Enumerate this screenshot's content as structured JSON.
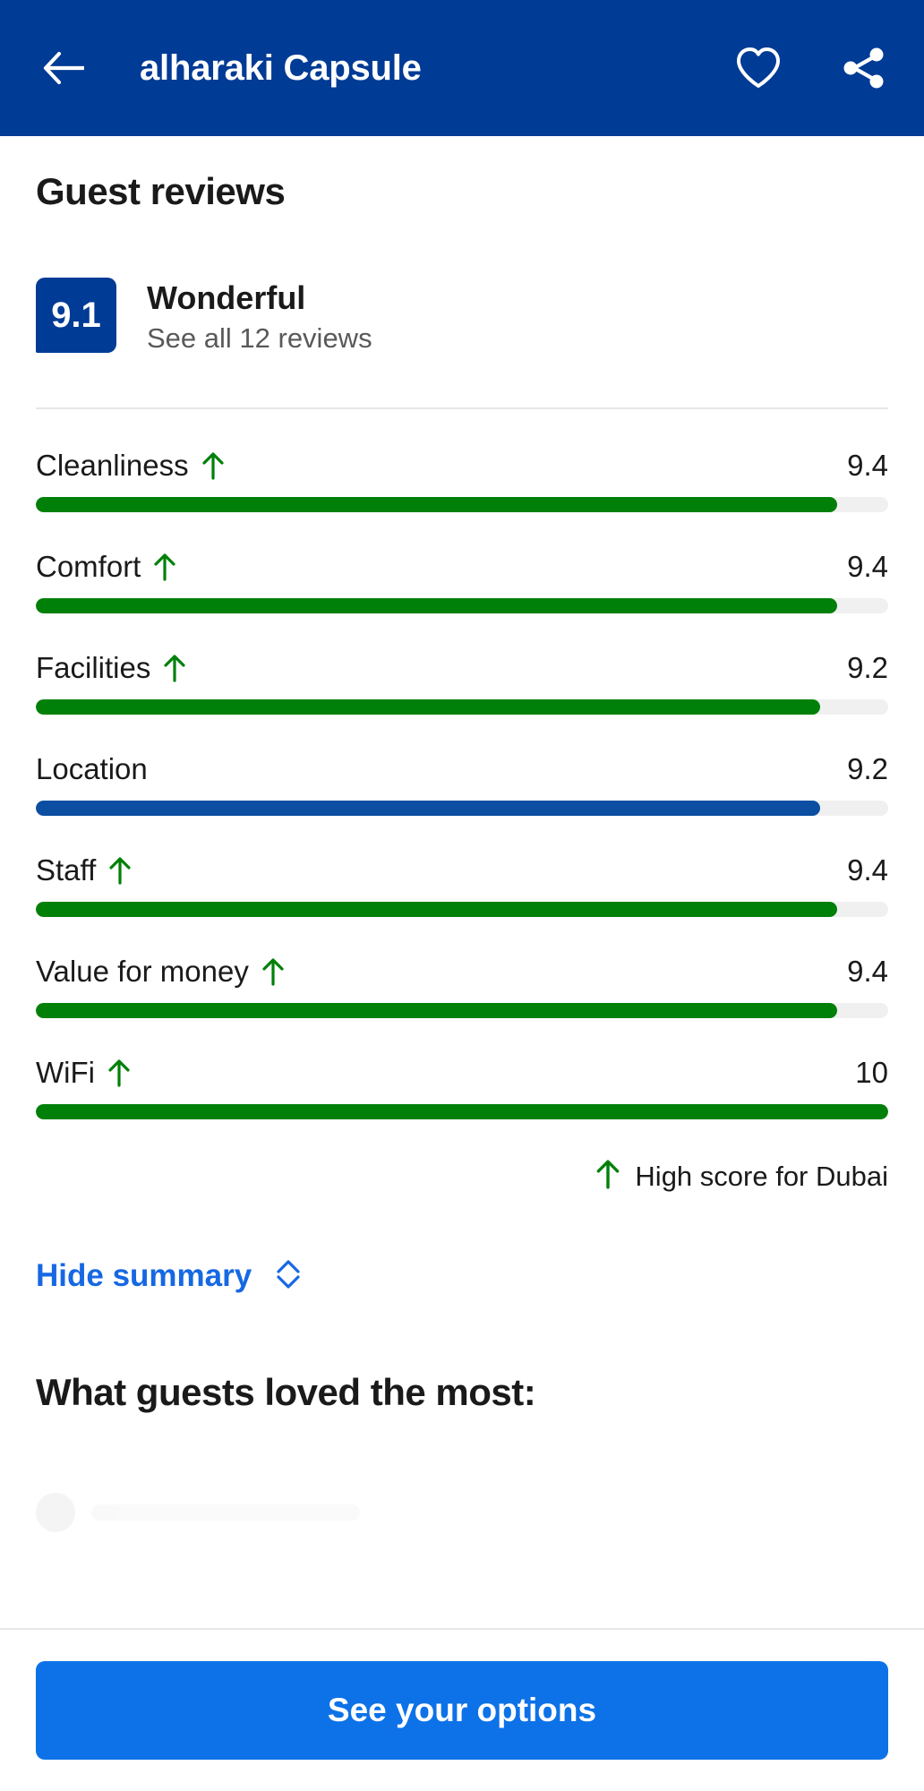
{
  "header": {
    "title": "alharaki Capsule",
    "back_icon": "back-arrow-icon",
    "favorite_icon": "heart-icon",
    "share_icon": "share-icon",
    "background_color": "#003b95"
  },
  "reviews": {
    "section_title": "Guest reviews",
    "score": "9.1",
    "score_word": "Wonderful",
    "see_all_label": "See all 12 reviews",
    "review_count": 12,
    "badge_color": "#003b95"
  },
  "categories": [
    {
      "label": "Cleanliness",
      "value": "9.4",
      "percent": 94,
      "color": "#008009",
      "high_score": true
    },
    {
      "label": "Comfort",
      "value": "9.4",
      "percent": 94,
      "color": "#008009",
      "high_score": true
    },
    {
      "label": "Facilities",
      "value": "9.2",
      "percent": 92,
      "color": "#008009",
      "high_score": true
    },
    {
      "label": "Location",
      "value": "9.2",
      "percent": 92,
      "color": "#0b4ea2",
      "high_score": false
    },
    {
      "label": "Staff",
      "value": "9.4",
      "percent": 94,
      "color": "#008009",
      "high_score": true
    },
    {
      "label": "Value for money",
      "value": "9.4",
      "percent": 94,
      "color": "#008009",
      "high_score": true
    },
    {
      "label": "WiFi",
      "value": "10",
      "percent": 100,
      "color": "#008009",
      "high_score": true
    }
  ],
  "legend": {
    "arrow_icon": "up-arrow-icon",
    "text": "High score for Dubai"
  },
  "summary_toggle": {
    "label": "Hide summary",
    "icon": "chevron-up-down-icon"
  },
  "loved": {
    "title": "What guests loved the most:"
  },
  "footer": {
    "cta_label": "See your options",
    "cta_color": "#0d72e8"
  },
  "colors": {
    "green": "#008009",
    "blue": "#0b4ea2",
    "brand_blue": "#003b95",
    "link_blue": "#1668e3",
    "track": "#f0f0f0"
  }
}
